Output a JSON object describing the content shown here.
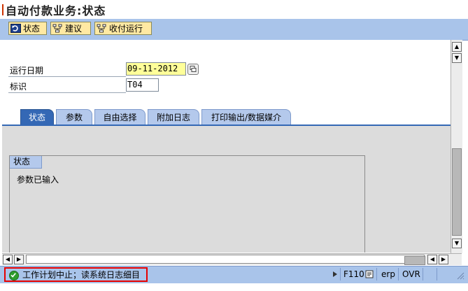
{
  "window": {
    "title": "自动付款业务:状态"
  },
  "toolbar": {
    "buttons": [
      {
        "label": "状态",
        "icon": "refresh-status-icon"
      },
      {
        "label": "建议",
        "icon": "proposal-icon"
      },
      {
        "label": "收付运行",
        "icon": "payment-run-icon"
      }
    ]
  },
  "form": {
    "run_date": {
      "label": "运行日期",
      "value": "09-11-2012"
    },
    "identification": {
      "label": "标识",
      "value": "T04"
    }
  },
  "tabs": [
    {
      "label": "状态",
      "active": true
    },
    {
      "label": "参数",
      "active": false
    },
    {
      "label": "自由选择",
      "active": false
    },
    {
      "label": "附加日志",
      "active": false
    },
    {
      "label": "打印输出/数据媒介",
      "active": false
    }
  ],
  "status_group": {
    "title": "状态",
    "message": "参数已输入"
  },
  "statusbar": {
    "message": "工作计划中止；读系统日志细目",
    "transaction": "F110",
    "system": "erp",
    "mode": "OVR"
  },
  "colors": {
    "toolbar_bg": "#a9c4ea",
    "active_tab": "#3468b5",
    "highlight_border": "#e60000",
    "success": "#2e9c2e"
  }
}
